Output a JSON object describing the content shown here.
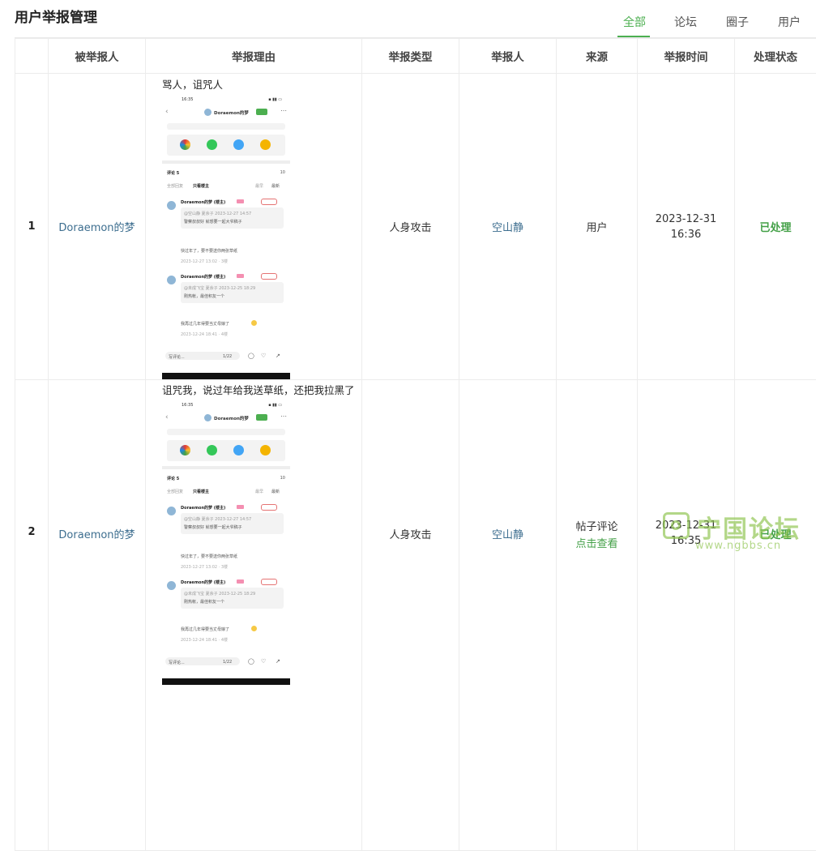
{
  "page": {
    "title": "用户举报管理"
  },
  "tabs": [
    {
      "label": "全部",
      "active": true
    },
    {
      "label": "论坛",
      "active": false
    },
    {
      "label": "圈子",
      "active": false
    },
    {
      "label": "用户",
      "active": false
    }
  ],
  "table": {
    "headers": [
      "",
      "被举报人",
      "举报理由",
      "举报类型",
      "举报人",
      "来源",
      "举报时间",
      "处理状态"
    ],
    "rows": [
      {
        "index": "1",
        "reported_user": "Doraemon的梦",
        "reason": "骂人，诅咒人",
        "type": "人身攻击",
        "reporter": "空山静",
        "source": "用户",
        "source_link": "",
        "time": "2023-12-31 16:36",
        "status": "已处理"
      },
      {
        "index": "2",
        "reported_user": "Doraemon的梦",
        "reason": "诅咒我，说过年给我送草纸，还把我拉黑了",
        "type": "人身攻击",
        "reporter": "空山静",
        "source": "帖子评论",
        "source_link": "点击查看",
        "time": "2023-12-31 16:35",
        "status": "已处理"
      }
    ]
  },
  "screenshot": {
    "time": "16:35",
    "name": "Doraemon的梦",
    "comments_label": "评论 5",
    "count": "10",
    "filter_all": "全部回复",
    "filter_host": "只看楼主",
    "sort_hot": "最早",
    "sort_new": "最新",
    "author": "Doraemon的梦 (楼主)",
    "comment1": "快过年了，要不要送你两张草纸",
    "comment1_meta": "2023-12-27 13:02 · 3楼",
    "comment2": "我再过几年得要当丈母娘了",
    "comment2_meta": "2023-12-24 18:41 · 4楼",
    "reply1": "@空山静 夏余子 2023-12-27 14:57",
    "reply1_text": "警察叔叔好 就想要一起大爷稿子",
    "reply2": "@未成飞宝 夏余子 2023-12-25 18:29",
    "reply2_text": "刚热帐，最佳积友一个",
    "input_placeholder": "写评论...",
    "page_indicator": "1/22"
  },
  "watermark": {
    "text": "宁国论坛",
    "url": "www.ngbbs.cn"
  },
  "colors": {
    "accent": "#4caf50",
    "link": "#3d6e8f",
    "status": "#43a047"
  }
}
